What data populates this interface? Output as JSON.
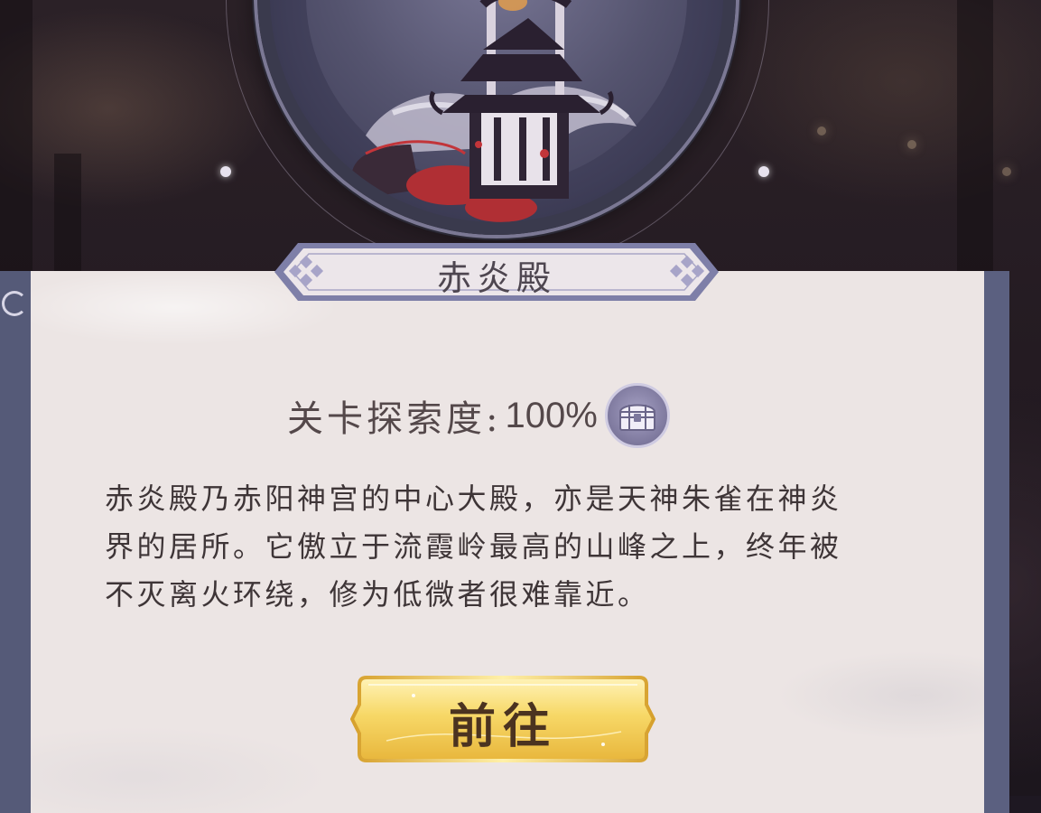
{
  "level": {
    "title": "赤炎殿",
    "image_icon": "temple-illustration-icon"
  },
  "exploration": {
    "label": "关卡探索度:",
    "value": "100%",
    "reward_icon": "treasure-chest-icon"
  },
  "description": {
    "lines": [
      "赤炎殿乃赤阳神宫的中心大殿，亦是天神朱雀在神炎",
      "界的居所。它傲立于流霞岭最高的山峰之上，终年被",
      "不灭离火环绕，修为低微者很难靠近。"
    ]
  },
  "action": {
    "go_label": "前往"
  },
  "colors": {
    "panel_bg": "#ece5e4",
    "panel_border": "#555a78",
    "button_gold": "#f3d66a",
    "text_dark": "#3e3537",
    "accent_red": "#c2353a"
  }
}
